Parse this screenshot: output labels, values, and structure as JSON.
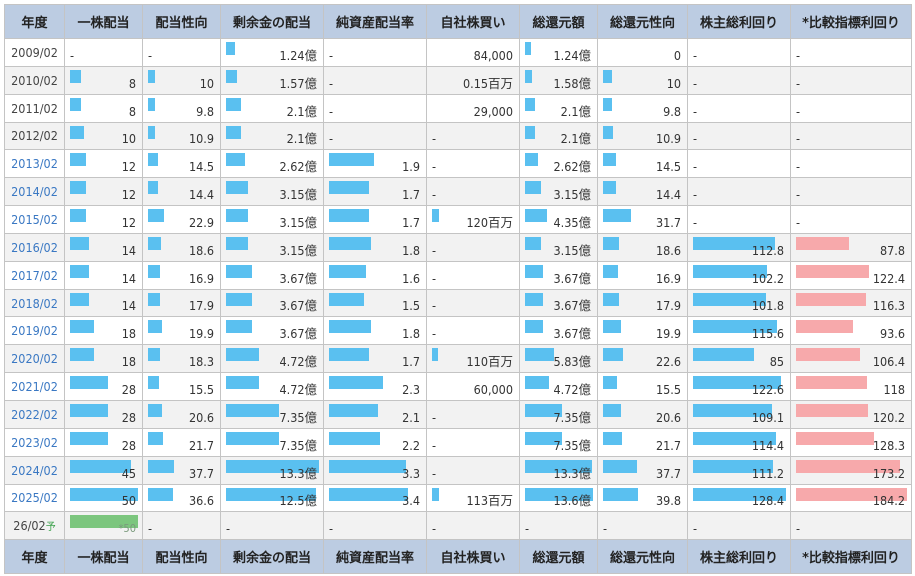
{
  "headers": [
    "年度",
    "一株配当",
    "配当性向",
    "剰余金の配当",
    "純資産配当率",
    "自社株買い",
    "総還元額",
    "総還元性向",
    "株主総利回り",
    "*比較指標利回り"
  ],
  "colors": {
    "header_bg": "#bccce2",
    "bar_blue": "#5ac0f0",
    "bar_red": "#f7a9ab",
    "bar_green": "#7cc67e",
    "link": "#3a78c3"
  },
  "rows": [
    {
      "year": "2009/02",
      "link": false,
      "cells": [
        "-",
        "-",
        "1.24億",
        "-",
        "84,000",
        "1.24億",
        "0",
        "-",
        "-"
      ],
      "bars": [
        null,
        null,
        0.1,
        null,
        null,
        0.09,
        0,
        null,
        null
      ]
    },
    {
      "year": "2010/02",
      "link": false,
      "cells": [
        "8",
        "10",
        "1.57億",
        "-",
        "0.15百万",
        "1.58億",
        "10",
        "-",
        "-"
      ],
      "bars": [
        0.16,
        0.1,
        0.12,
        null,
        0,
        0.11,
        0.11,
        null,
        null
      ]
    },
    {
      "year": "2011/02",
      "link": false,
      "cells": [
        "8",
        "9.8",
        "2.1億",
        "-",
        "29,000",
        "2.1億",
        "9.8",
        "-",
        "-"
      ],
      "bars": [
        0.16,
        0.1,
        0.16,
        null,
        null,
        0.15,
        0.11,
        null,
        null
      ]
    },
    {
      "year": "2012/02",
      "link": false,
      "cells": [
        "10",
        "10.9",
        "2.1億",
        "-",
        "-",
        "2.1億",
        "10.9",
        "-",
        "-"
      ],
      "bars": [
        0.2,
        0.11,
        0.16,
        null,
        null,
        0.15,
        0.12,
        null,
        null
      ]
    },
    {
      "year": "2013/02",
      "link": true,
      "cells": [
        "12",
        "14.5",
        "2.62億",
        "1.9",
        "-",
        "2.62億",
        "14.5",
        "-",
        "-"
      ],
      "bars": [
        0.24,
        0.15,
        0.2,
        0.48,
        null,
        0.19,
        0.16,
        null,
        null
      ]
    },
    {
      "year": "2014/02",
      "link": true,
      "cells": [
        "12",
        "14.4",
        "3.15億",
        "1.7",
        "-",
        "3.15億",
        "14.4",
        "-",
        "-"
      ],
      "bars": [
        0.24,
        0.15,
        0.24,
        0.43,
        null,
        0.23,
        0.16,
        null,
        null
      ]
    },
    {
      "year": "2015/02",
      "link": true,
      "cells": [
        "12",
        "22.9",
        "3.15億",
        "1.7",
        "120百万",
        "4.35億",
        "31.7",
        "-",
        "-"
      ],
      "bars": [
        0.24,
        0.23,
        0.24,
        0.43,
        0.08,
        0.32,
        0.35,
        null,
        null
      ]
    },
    {
      "year": "2016/02",
      "link": true,
      "cells": [
        "14",
        "18.6",
        "3.15億",
        "1.8",
        "-",
        "3.15億",
        "18.6",
        "112.8",
        "87.8"
      ],
      "bars": [
        0.28,
        0.19,
        0.24,
        0.45,
        null,
        0.23,
        0.2,
        0.88,
        0.48
      ]
    },
    {
      "year": "2017/02",
      "link": true,
      "cells": [
        "14",
        "16.9",
        "3.67億",
        "1.6",
        "-",
        "3.67億",
        "16.9",
        "102.2",
        "122.4"
      ],
      "bars": [
        0.28,
        0.17,
        0.28,
        0.4,
        null,
        0.27,
        0.19,
        0.8,
        0.66
      ]
    },
    {
      "year": "2018/02",
      "link": true,
      "cells": [
        "14",
        "17.9",
        "3.67億",
        "1.5",
        "-",
        "3.67億",
        "17.9",
        "101.8",
        "116.3"
      ],
      "bars": [
        0.28,
        0.18,
        0.28,
        0.38,
        null,
        0.27,
        0.2,
        0.79,
        0.63
      ]
    },
    {
      "year": "2019/02",
      "link": true,
      "cells": [
        "18",
        "19.9",
        "3.67億",
        "1.8",
        "-",
        "3.67億",
        "19.9",
        "115.6",
        "93.6"
      ],
      "bars": [
        0.36,
        0.2,
        0.28,
        0.45,
        null,
        0.27,
        0.22,
        0.9,
        0.51
      ]
    },
    {
      "year": "2020/02",
      "link": true,
      "cells": [
        "18",
        "18.3",
        "4.72億",
        "1.7",
        "110百万",
        "5.83億",
        "22.6",
        "85",
        "106.4"
      ],
      "bars": [
        0.36,
        0.18,
        0.36,
        0.43,
        0.07,
        0.43,
        0.25,
        0.66,
        0.58
      ]
    },
    {
      "year": "2021/02",
      "link": true,
      "cells": [
        "28",
        "15.5",
        "4.72億",
        "2.3",
        "60,000",
        "4.72億",
        "15.5",
        "122.6",
        "118"
      ],
      "bars": [
        0.56,
        0.16,
        0.36,
        0.58,
        null,
        0.35,
        0.17,
        0.95,
        0.64
      ]
    },
    {
      "year": "2022/02",
      "link": true,
      "cells": [
        "28",
        "20.6",
        "7.35億",
        "2.1",
        "-",
        "7.35億",
        "20.6",
        "109.1",
        "120.2"
      ],
      "bars": [
        0.56,
        0.21,
        0.57,
        0.53,
        null,
        0.54,
        0.23,
        0.85,
        0.65
      ]
    },
    {
      "year": "2023/02",
      "link": true,
      "cells": [
        "28",
        "21.7",
        "7.35億",
        "2.2",
        "-",
        "7.35億",
        "21.7",
        "114.4",
        "128.3"
      ],
      "bars": [
        0.56,
        0.22,
        0.57,
        0.55,
        null,
        0.54,
        0.24,
        0.89,
        0.7
      ]
    },
    {
      "year": "2024/02",
      "link": true,
      "cells": [
        "45",
        "37.7",
        "13.3億",
        "3.3",
        "-",
        "13.3億",
        "37.7",
        "111.2",
        "173.2"
      ],
      "bars": [
        0.9,
        0.38,
        1.0,
        0.83,
        null,
        0.98,
        0.42,
        0.86,
        0.94
      ]
    },
    {
      "year": "2025/02",
      "link": true,
      "cells": [
        "50",
        "36.6",
        "12.5億",
        "3.4",
        "113百万",
        "13.6億",
        "39.8",
        "128.4",
        "184.2"
      ],
      "bars": [
        1.0,
        0.37,
        0.97,
        0.85,
        0.08,
        1.0,
        0.44,
        1.0,
        1.0
      ]
    },
    {
      "year": "26/02",
      "yo": "予",
      "link": false,
      "cells": [
        "*50",
        "-",
        "-",
        "-",
        "-",
        "-",
        "-",
        "-",
        "-"
      ],
      "est": true,
      "bars": [
        1.0,
        null,
        null,
        null,
        null,
        null,
        null,
        null,
        null
      ]
    }
  ]
}
